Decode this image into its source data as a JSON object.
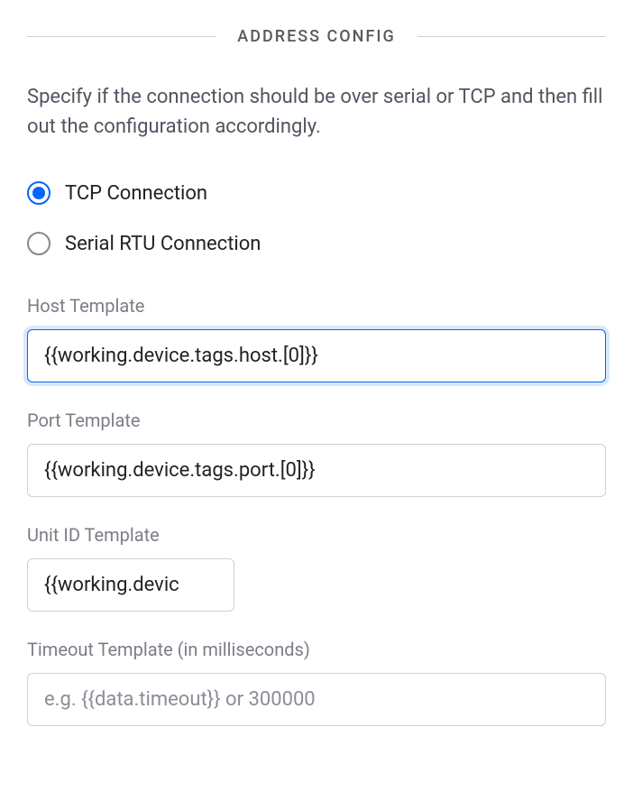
{
  "section": {
    "title": "ADDRESS CONFIG",
    "description": "Specify if the connection should be over serial or TCP and then fill out the configuration accordingly."
  },
  "radio": {
    "tcp_label": "TCP Connection",
    "serial_label": "Serial RTU Connection",
    "selected": "tcp"
  },
  "fields": {
    "host": {
      "label": "Host Template",
      "value": "{{working.device.tags.host.[0]}}",
      "placeholder": ""
    },
    "port": {
      "label": "Port Template",
      "value": "{{working.device.tags.port.[0]}}",
      "placeholder": ""
    },
    "unit_id": {
      "label": "Unit ID Template",
      "value": "{{working.devic",
      "placeholder": ""
    },
    "timeout": {
      "label": "Timeout Template (in milliseconds)",
      "value": "",
      "placeholder": "e.g. {{data.timeout}} or 300000"
    }
  }
}
